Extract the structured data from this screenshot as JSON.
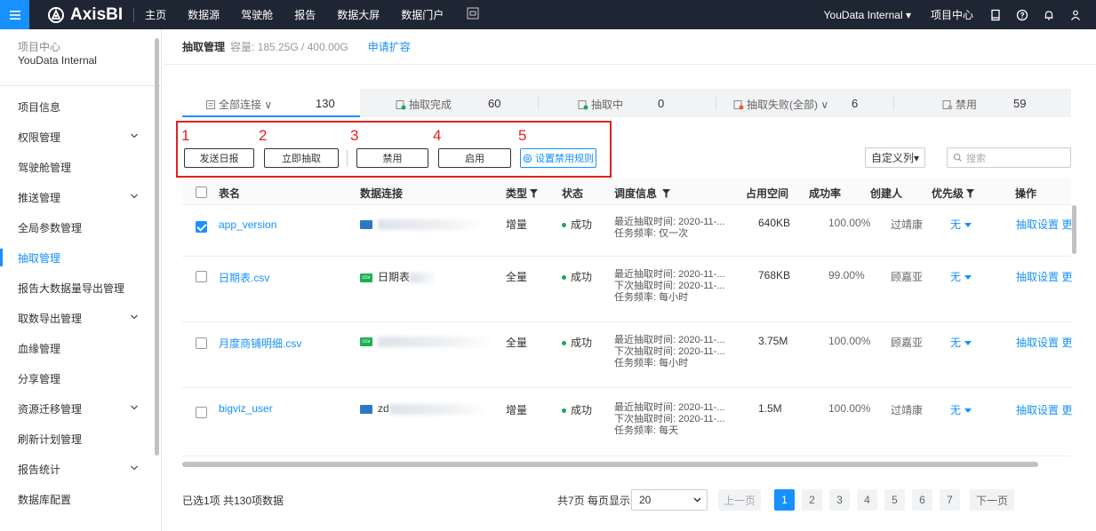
{
  "topbar": {
    "logo_text": "AxisBI",
    "nav": [
      "主页",
      "数据源",
      "驾驶舱",
      "报告",
      "数据大屏",
      "数据门户"
    ],
    "org": "YouData Internal ▾",
    "project_center": "项目中心",
    "brand_color": "#1890ff",
    "icons": [
      "menu-icon",
      "screen-icon",
      "bookmark-icon",
      "help-icon",
      "bell-icon",
      "user-icon"
    ]
  },
  "sidebar": {
    "subtitle": "项目中心",
    "title": "YouData Internal",
    "items": [
      {
        "label": "项目信息",
        "expand": false
      },
      {
        "label": "权限管理",
        "expand": true
      },
      {
        "label": "驾驶舱管理",
        "expand": false
      },
      {
        "label": "推送管理",
        "expand": true
      },
      {
        "label": "全局参数管理",
        "expand": false
      },
      {
        "label": "抽取管理",
        "expand": false,
        "active": true
      },
      {
        "label": "报告大数据量导出管理",
        "expand": false
      },
      {
        "label": "取数导出管理",
        "expand": true
      },
      {
        "label": "血缘管理",
        "expand": false
      },
      {
        "label": "分享管理",
        "expand": false
      },
      {
        "label": "资源迁移管理",
        "expand": true
      },
      {
        "label": "刷新计划管理",
        "expand": false
      },
      {
        "label": "报告统计",
        "expand": true
      },
      {
        "label": "数据库配置",
        "expand": false
      }
    ],
    "partial_item": "…"
  },
  "header": {
    "title": "抽取管理",
    "capacity": "容量: 185.25G / 400.00G",
    "apply_link": "申请扩容"
  },
  "tabs": [
    {
      "label": "全部连接 ∨",
      "count": "130",
      "active": true
    },
    {
      "label": "抽取完成",
      "count": "60"
    },
    {
      "label": "抽取中",
      "count": "0"
    },
    {
      "label": "抽取失败(全部) ∨",
      "count": "6",
      "color": "#f05a2a"
    },
    {
      "label": "禁用",
      "count": "59"
    }
  ],
  "annotations": [
    "1",
    "2",
    "3",
    "4",
    "5"
  ],
  "toolbar": {
    "daily_report": "发送日报",
    "extract_now": "立即抽取",
    "disable": "禁用",
    "enable": "启用",
    "disable_rules": "设置禁用规则",
    "custom_columns": "自定义列▾",
    "search_placeholder": "搜索"
  },
  "table": {
    "headers": [
      "表名",
      "数据连接",
      "类型",
      "状态",
      "调度信息",
      "占用空间",
      "成功率",
      "创建人",
      "优先级",
      "操作"
    ],
    "rows": [
      {
        "checked": true,
        "name": "app_version",
        "conn_type": "db",
        "conn_label": "",
        "type": "增量",
        "status": "成功",
        "sched": [
          "最近抽取时间: 2020-11-...",
          "任务频率: 仅一次"
        ],
        "size": "640KB",
        "rate": "100.00%",
        "creator": "过靖康",
        "priority": "无",
        "action": "抽取设置 更"
      },
      {
        "checked": false,
        "name": "日期表.csv",
        "conn_type": "csv",
        "conn_label": "日期表",
        "type": "全量",
        "status": "成功",
        "sched": [
          "最近抽取时间: 2020-11-...",
          "下次抽取时间: 2020-11-...",
          "任务频率: 每小时"
        ],
        "size": "768KB",
        "rate": "99.00%",
        "creator": "顾嘉亚",
        "priority": "无",
        "action": "抽取设置 更"
      },
      {
        "checked": false,
        "name": "月度商铺明细.csv",
        "conn_type": "csv",
        "conn_label": "",
        "type": "全量",
        "status": "成功",
        "sched": [
          "最近抽取时间: 2020-11-...",
          "下次抽取时间: 2020-11-...",
          "任务频率: 每小时"
        ],
        "size": "3.75M",
        "rate": "100.00%",
        "creator": "顾嘉亚",
        "priority": "无",
        "action": "抽取设置 更"
      },
      {
        "checked": false,
        "name": "bigviz_user",
        "conn_type": "db",
        "conn_label": "zd",
        "type": "增量",
        "status": "成功",
        "sched": [
          "最近抽取时间: 2020-11-...",
          "下次抽取时间: 2020-11-...",
          "任务频率: 每天"
        ],
        "size": "1.5M",
        "rate": "100.00%",
        "creator": "过靖康",
        "priority": "无",
        "action": "抽取设置 更"
      }
    ]
  },
  "footer": {
    "info": "已选1项  共130项数据",
    "pages": "共7页  每页显示",
    "page_size": "20",
    "prev": "上一页",
    "next": "下一页",
    "page_numbers": [
      "1",
      "2",
      "3",
      "4",
      "5",
      "6",
      "7"
    ],
    "current_page": "1"
  }
}
